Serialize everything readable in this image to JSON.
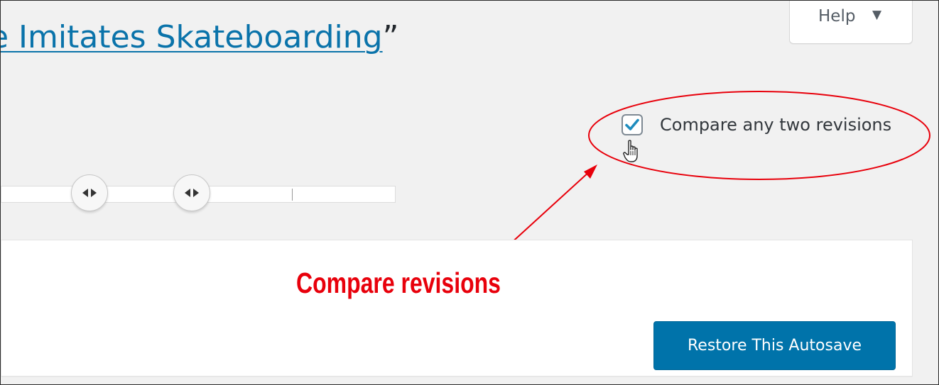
{
  "header": {
    "help_label": "Help",
    "help_caret": "▼",
    "title_link_text": "e Imitates Skateboarding",
    "title_close_quote": "”"
  },
  "compare": {
    "label": "Compare any two revisions",
    "checked": true
  },
  "slider": {
    "handle_glyph_left": "◀",
    "handle_glyph_right": "▶"
  },
  "actions": {
    "restore_label": "Restore This Autosave"
  },
  "annotation": {
    "label": "Compare revisions",
    "color": "#e8000b"
  },
  "colors": {
    "accent": "#0073aa",
    "link": "#0a73aa",
    "background": "#f1f1f1"
  }
}
